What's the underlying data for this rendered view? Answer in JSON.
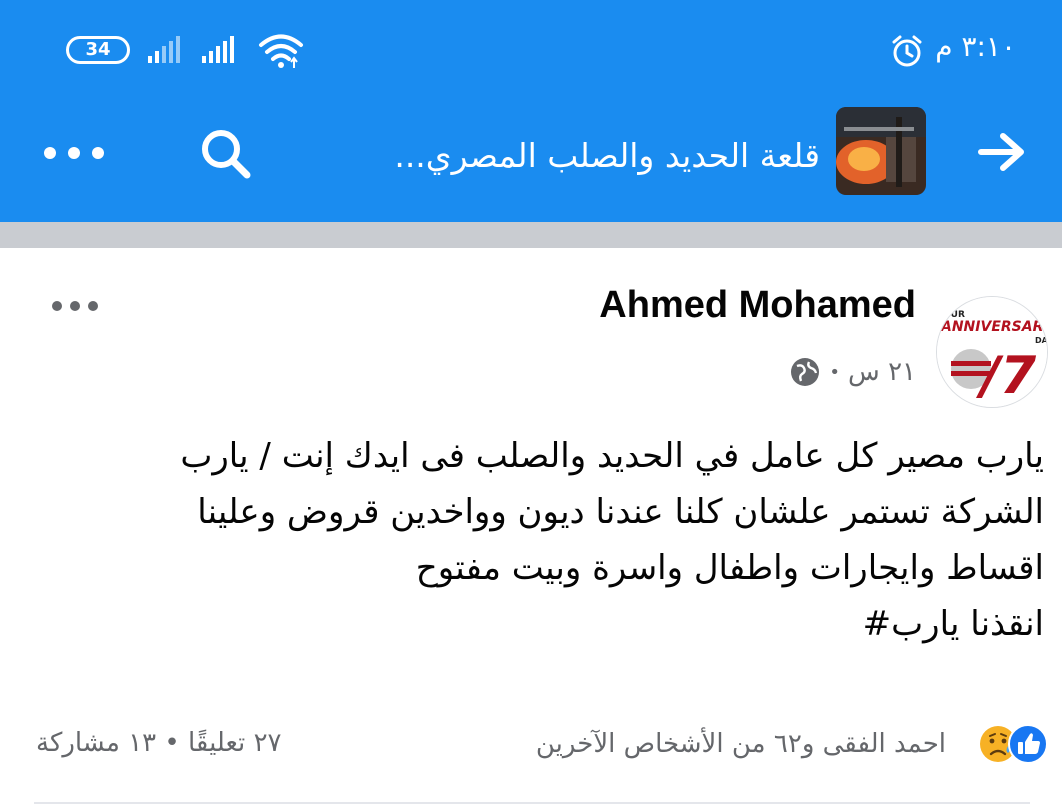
{
  "status_bar": {
    "time": "٣:١٠ م",
    "battery": "34"
  },
  "app_bar": {
    "group_title": "قلعة الحديد والصلب المصري..."
  },
  "post": {
    "author": "Ahmed Mohamed",
    "time": "٢١ س",
    "separator": "•",
    "avatar_text_top": "OUR",
    "avatar_text_main": "ANNIVERSAR",
    "avatar_text_side": "DA",
    "avatar_number": "/7",
    "lines": [
      "يارب مصير كل عامل في الحديد والصلب فى ايدك إنت / يارب",
      "الشركة تستمر علشان كلنا عندنا ديون وواخدين قروض وعلينا",
      "اقساط وايجارات واطفال واسرة وبيت مفتوح",
      "انقذنا يارب#"
    ],
    "reactors": "احمد الفقى و٦٢ من الأشخاص الآخرين",
    "counts": "٢٧ تعليقًا • ١٣ مشاركة"
  },
  "colors": {
    "brand_blue": "#1a8cf0",
    "band_gray": "#c9ccd1",
    "meta_gray": "#65676b",
    "like_blue": "#1877f2",
    "sad_yellow": "#f7b125"
  },
  "icons": {
    "more_top": "more-horizontal-icon",
    "search": "search-icon",
    "back": "arrow-right-icon",
    "post_more": "more-horizontal-icon",
    "globe": "globe-icon",
    "like": "like-reaction-icon",
    "sad": "sad-reaction-icon",
    "alarm": "alarm-clock-icon",
    "wifi": "wifi-icon",
    "signal": "signal-icon"
  }
}
